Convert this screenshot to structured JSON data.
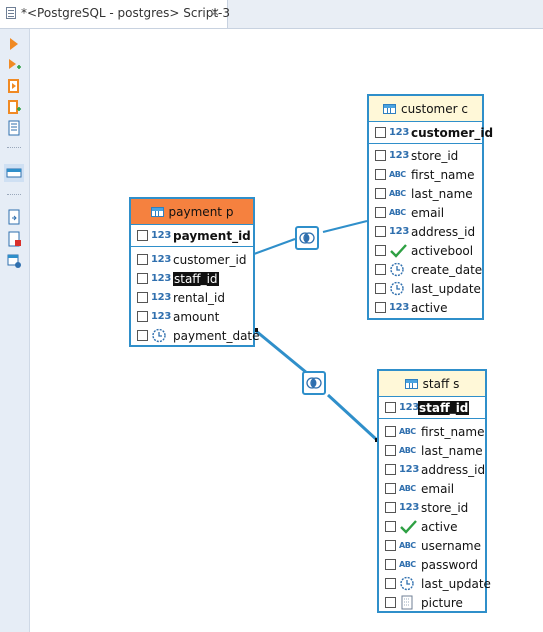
{
  "tab": {
    "title": "*<PostgreSQL - postgres> Script-3",
    "close": "⨯",
    "icon": "sql-script-icon"
  },
  "sidebar": {
    "tools": [
      "run-statement-icon",
      "run-statement-new-tab-icon",
      "execute-script-icon",
      "execute-script-new-tab-icon",
      "explain-plan-icon",
      "results-panel-icon",
      "export-icon",
      "error-log-icon",
      "settings-icon"
    ]
  },
  "entities": {
    "payment": {
      "title": "payment p",
      "header_color": "#f5813f",
      "pk": {
        "name": "payment_id",
        "type": "123"
      },
      "columns": [
        {
          "name": "customer_id",
          "type": "123"
        },
        {
          "name": "staff_id",
          "type": "123",
          "highlighted": true
        },
        {
          "name": "rental_id",
          "type": "123"
        },
        {
          "name": "amount",
          "type": "123"
        },
        {
          "name": "payment_date",
          "type": "datetime"
        }
      ]
    },
    "customer": {
      "title": "customer c",
      "header_color": "#fff8d8",
      "pk": {
        "name": "customer_id",
        "type": "123"
      },
      "columns": [
        {
          "name": "store_id",
          "type": "123"
        },
        {
          "name": "first_name",
          "type": "ABC"
        },
        {
          "name": "last_name",
          "type": "ABC"
        },
        {
          "name": "email",
          "type": "ABC"
        },
        {
          "name": "address_id",
          "type": "123"
        },
        {
          "name": "activebool",
          "type": "boolean"
        },
        {
          "name": "create_date",
          "type": "datetime"
        },
        {
          "name": "last_update",
          "type": "datetime"
        },
        {
          "name": "active",
          "type": "123"
        }
      ]
    },
    "staff": {
      "title": "staff s",
      "header_color": "#fff8d8",
      "pk": {
        "name": "staff_id",
        "type": "123",
        "highlighted": true
      },
      "columns": [
        {
          "name": "first_name",
          "type": "ABC"
        },
        {
          "name": "last_name",
          "type": "ABC"
        },
        {
          "name": "address_id",
          "type": "123"
        },
        {
          "name": "email",
          "type": "ABC"
        },
        {
          "name": "store_id",
          "type": "123"
        },
        {
          "name": "active",
          "type": "boolean"
        },
        {
          "name": "username",
          "type": "ABC"
        },
        {
          "name": "password",
          "type": "ABC"
        },
        {
          "name": "last_update",
          "type": "datetime"
        },
        {
          "name": "picture",
          "type": "binary"
        }
      ]
    }
  },
  "joins": [
    {
      "from": "payment",
      "to": "customer",
      "kind": "inner-join-icon"
    },
    {
      "from": "payment",
      "to": "staff",
      "kind": "inner-join-icon"
    }
  ],
  "colors": {
    "accent": "#2f8fca",
    "type_text": "#2f6fae",
    "check": "#2ea043"
  }
}
